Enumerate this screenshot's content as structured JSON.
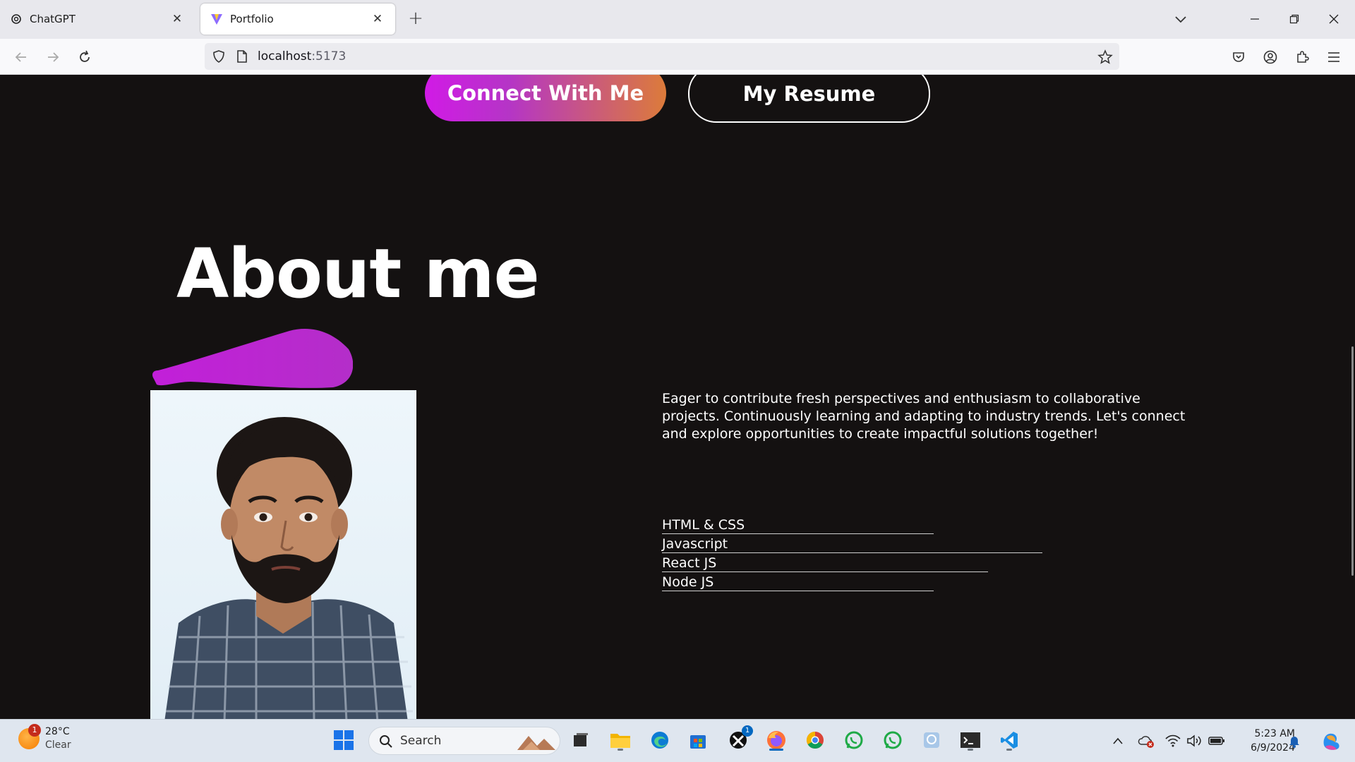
{
  "browser": {
    "tabs": [
      {
        "title": "ChatGPT",
        "active": false,
        "icon": "chatgpt-icon"
      },
      {
        "title": "Portfolio",
        "active": true,
        "icon": "vite-icon"
      }
    ],
    "url": {
      "host": "localhost",
      "port": ":5173"
    }
  },
  "hero": {
    "connect_label": "Connect With Me",
    "resume_label": "My Resume"
  },
  "about": {
    "title": "About me",
    "bio": "Eager to contribute fresh perspectives and enthusiasm to collaborative projects. Continuously learning and adapting to industry trends. Let's connect and explore opportunities to create impactful solutions together!",
    "skills": [
      {
        "name": "HTML & CSS",
        "level_percent": 50
      },
      {
        "name": "Javascript",
        "level_percent": 70
      },
      {
        "name": "React JS",
        "level_percent": 60
      },
      {
        "name": "Node JS",
        "level_percent": 50
      }
    ]
  },
  "colors": {
    "page_bg": "#141111",
    "accent_start": "#d11ae6",
    "accent_end": "#dc7b3a"
  },
  "taskbar": {
    "weather": {
      "temp": "28°C",
      "condition": "Clear",
      "badge": "1"
    },
    "search_label": "Search",
    "apps": [
      "task-view",
      "file-explorer",
      "edge",
      "microsoft-store",
      "xbox",
      "firefox",
      "chrome",
      "whatsapp",
      "whatsapp-beta",
      "photos",
      "terminal",
      "vscode"
    ],
    "xbox_badge": "1",
    "clock": {
      "time": "5:23 AM",
      "date": "6/9/2024"
    }
  }
}
